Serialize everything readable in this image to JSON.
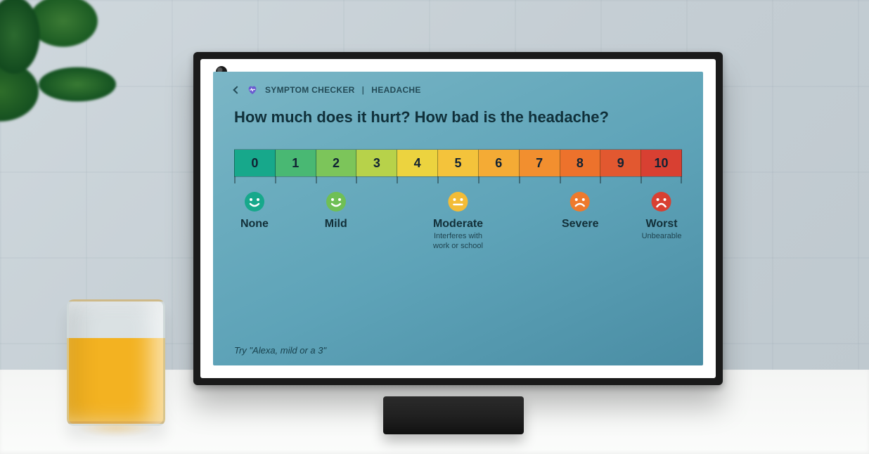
{
  "header": {
    "app": "SYMPTOM CHECKER",
    "separator": "|",
    "context": "HEADACHE"
  },
  "question": "How much does it hurt? How bad is the headache?",
  "scale": {
    "cells": [
      {
        "value": "0",
        "color": "#17a88b"
      },
      {
        "value": "1",
        "color": "#49b873"
      },
      {
        "value": "2",
        "color": "#7cc55a"
      },
      {
        "value": "3",
        "color": "#b7d24a"
      },
      {
        "value": "4",
        "color": "#ecd33f"
      },
      {
        "value": "5",
        "color": "#f4c33b"
      },
      {
        "value": "6",
        "color": "#f4ab35"
      },
      {
        "value": "7",
        "color": "#f28f2f"
      },
      {
        "value": "8",
        "color": "#ed722c"
      },
      {
        "value": "9",
        "color": "#e25830"
      },
      {
        "value": "10",
        "color": "#d84032"
      }
    ],
    "labels": [
      {
        "at": 0,
        "name": "None",
        "sub": "",
        "face": "happy",
        "faceColor": "#17a88b"
      },
      {
        "at": 2,
        "name": "Mild",
        "sub": "",
        "face": "happy",
        "faceColor": "#6fbf55"
      },
      {
        "at": 5,
        "name": "Moderate",
        "sub": "Interferes with\nwork or school",
        "face": "neutral",
        "faceColor": "#f3bc37"
      },
      {
        "at": 8,
        "name": "Severe",
        "sub": "",
        "face": "sad",
        "faceColor": "#ee7a2d"
      },
      {
        "at": 10,
        "name": "Worst",
        "sub": "Unbearable",
        "face": "worst",
        "faceColor": "#d84032"
      }
    ]
  },
  "hint": "Try \"Alexa, mild or a 3\""
}
